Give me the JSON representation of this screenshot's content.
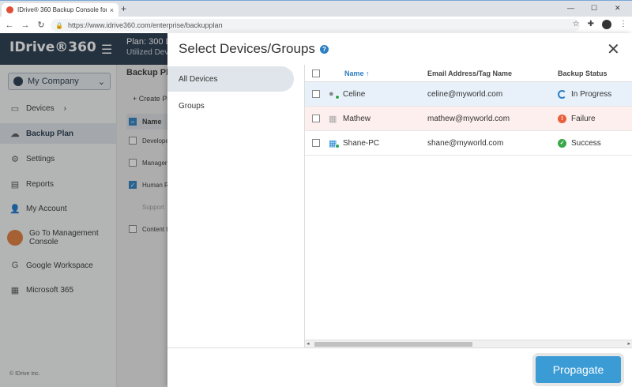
{
  "browser": {
    "tab_title": "IDrive® 360 Backup Console for",
    "tab_close": "×",
    "new_tab": "+",
    "url": "https://www.idrive360.com/enterprise/backupplan",
    "minimize": "—",
    "maximize": "☐",
    "close": "✕"
  },
  "header": {
    "logo": "IDrive®360",
    "plan_line1": "Plan: 300 L",
    "plan_line2": "Utilized Devic"
  },
  "sidebar": {
    "company": "My Company",
    "items": [
      {
        "label": "Devices"
      },
      {
        "label": "Backup Plan"
      },
      {
        "label": "Settings"
      },
      {
        "label": "Reports"
      },
      {
        "label": "My Account"
      },
      {
        "label": "Go To Management Console"
      },
      {
        "label": "Google Workspace"
      },
      {
        "label": "Microsoft 365"
      }
    ],
    "copyright": "© IDrive Inc."
  },
  "background_page": {
    "title": "Backup Pla",
    "create_label": "Create Pl",
    "col_name": "Name",
    "rows": [
      {
        "label": "Develope"
      },
      {
        "label": "Manager"
      },
      {
        "label": "Human R"
      },
      {
        "label": "Support"
      },
      {
        "label": "Content t"
      }
    ]
  },
  "dialog": {
    "title": "Select Devices/Groups",
    "help": "?",
    "close": "✕",
    "tabs": [
      {
        "label": "All Devices"
      },
      {
        "label": "Groups"
      }
    ],
    "columns": {
      "name": "Name",
      "sort_indicator": "↑",
      "email": "Email Address/Tag Name",
      "status": "Backup Status"
    },
    "devices": [
      {
        "name": "Celine",
        "email": "celine@myworld.com",
        "status": "In Progress",
        "os": "apple-icon"
      },
      {
        "name": "Mathew",
        "email": "mathew@myworld.com",
        "status": "Failure",
        "os": "windows-icon"
      },
      {
        "name": "Shane-PC",
        "email": "shane@myworld.com",
        "status": "Success",
        "os": "windows-icon"
      }
    ],
    "propagate_label": "Propagate"
  }
}
